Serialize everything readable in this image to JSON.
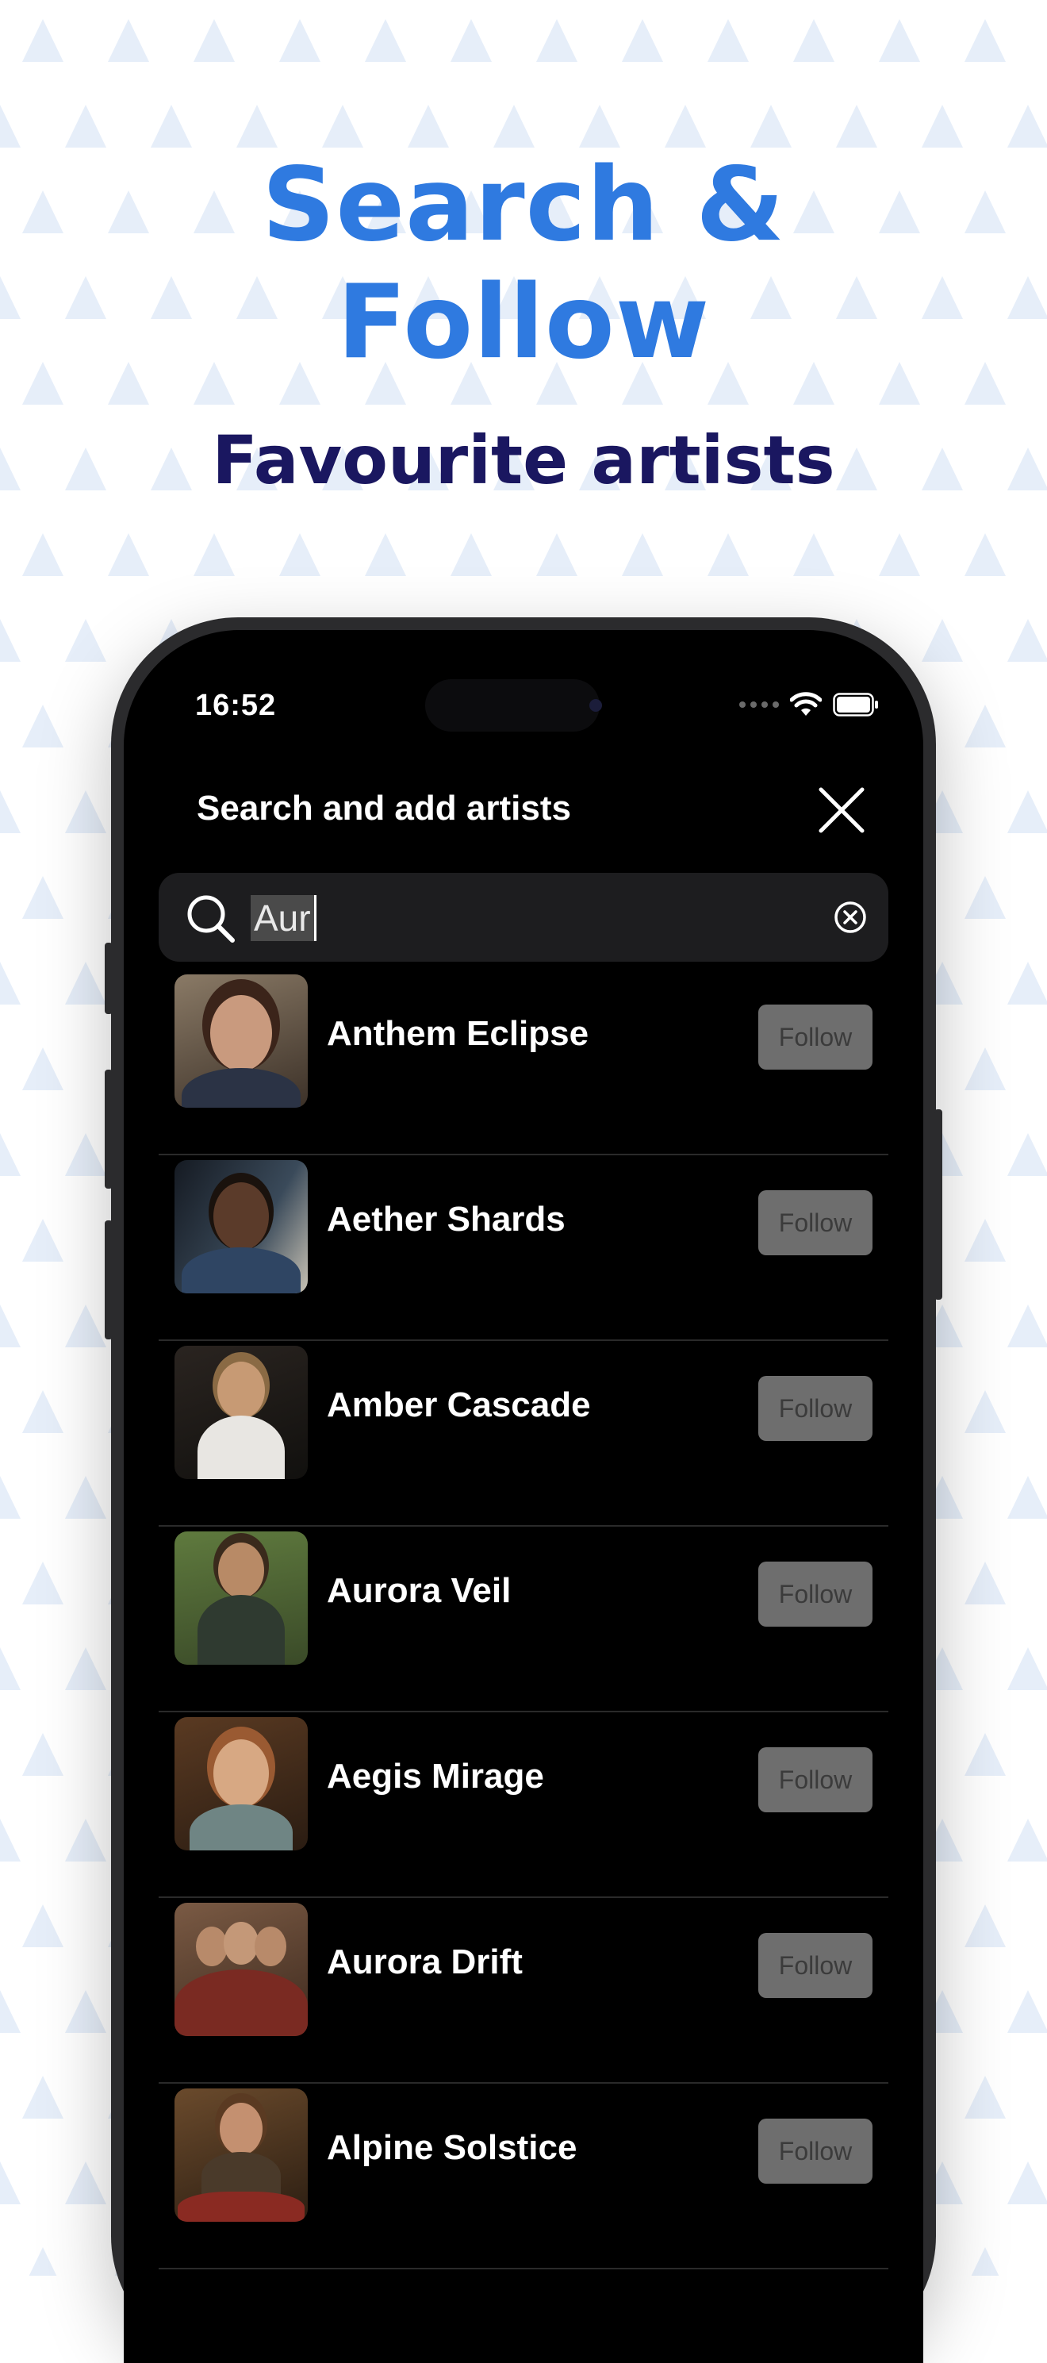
{
  "promo": {
    "headline_line1": "Search &",
    "headline_line2": "Follow",
    "subheadline": "Favourite artists",
    "accent_color": "#2f7ae0",
    "sub_color": "#1a1760"
  },
  "status_bar": {
    "time": "16:52",
    "icons": [
      "signal-dots-icon",
      "wifi-icon",
      "battery-icon"
    ]
  },
  "sheet": {
    "title": "Search and add artists",
    "close_icon": "close-icon"
  },
  "search": {
    "value": "Aur",
    "icon": "search-icon",
    "clear_icon": "clear-icon"
  },
  "artists": [
    {
      "name": "Anthem Eclipse",
      "follow_label": "Follow",
      "photo": "portrait-woman-dark-hair"
    },
    {
      "name": "Aether Shards",
      "follow_label": "Follow",
      "photo": "portrait-man-in-car"
    },
    {
      "name": "Amber Cascade",
      "follow_label": "Follow",
      "photo": "guitarist-on-stage"
    },
    {
      "name": "Aurora Veil",
      "follow_label": "Follow",
      "photo": "man-on-bicycle-park"
    },
    {
      "name": "Aegis Mirage",
      "follow_label": "Follow",
      "photo": "woman-in-cafe"
    },
    {
      "name": "Aurora Drift",
      "follow_label": "Follow",
      "photo": "three-piece-band"
    },
    {
      "name": "Alpine Solstice",
      "follow_label": "Follow",
      "photo": "drummer-on-kit"
    }
  ]
}
